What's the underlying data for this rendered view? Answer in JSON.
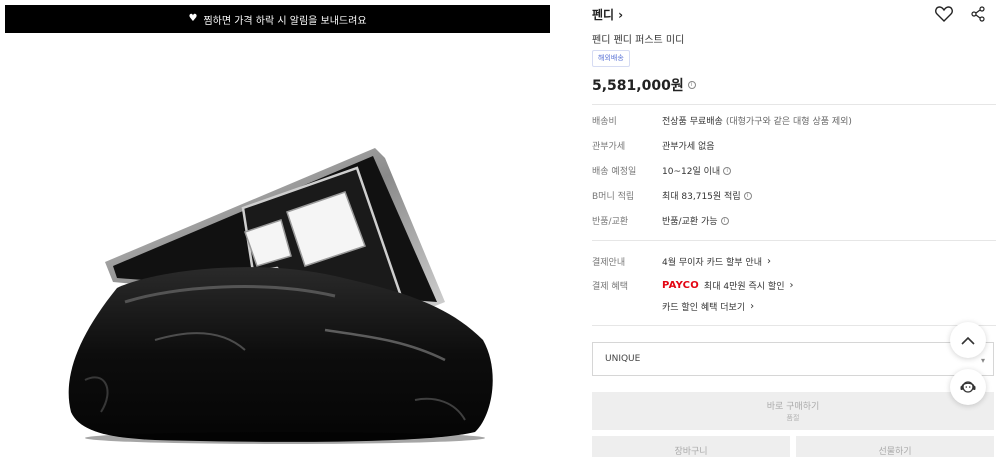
{
  "banner": {
    "icon": "heart-icon",
    "text": "찜하면 가격 하락 시 알림을 보내드려요"
  },
  "product": {
    "brand": "펜디",
    "name": "펜디 펜디 퍼스트 미디",
    "badge": "해외배송",
    "price": "5,581,000원"
  },
  "info_rows": [
    {
      "key": "배송비",
      "value": "전상품 무료배송",
      "sub": "(대형가구와 같은 대형 상품 제외)"
    },
    {
      "key": "관부가세",
      "value": "관부가세 없음"
    },
    {
      "key": "배송 예정일",
      "value": "10~12일 이내"
    },
    {
      "key": "B머니 적립",
      "value": "최대 83,715원 적립"
    },
    {
      "key": "반품/교환",
      "value": "반품/교환 가능"
    }
  ],
  "payment": {
    "guide_key": "결제안내",
    "guide_value": "4월 무이자 카드 할부 안내",
    "benefit_key": "결제 혜택",
    "payco_logo": "PAYCO",
    "payco_text": "최대 4만원 즉시 할인",
    "card_benefit": "카드 할인 혜택 더보기"
  },
  "option_select": {
    "value": "UNIQUE"
  },
  "buttons": {
    "buy": "바로 구매하기",
    "buy_sub": "품절",
    "cart": "장바구니",
    "gift": "선물하기"
  },
  "colors": {
    "payco": "#e30613",
    "badge": "#5b74d6",
    "banner": "#000000"
  }
}
